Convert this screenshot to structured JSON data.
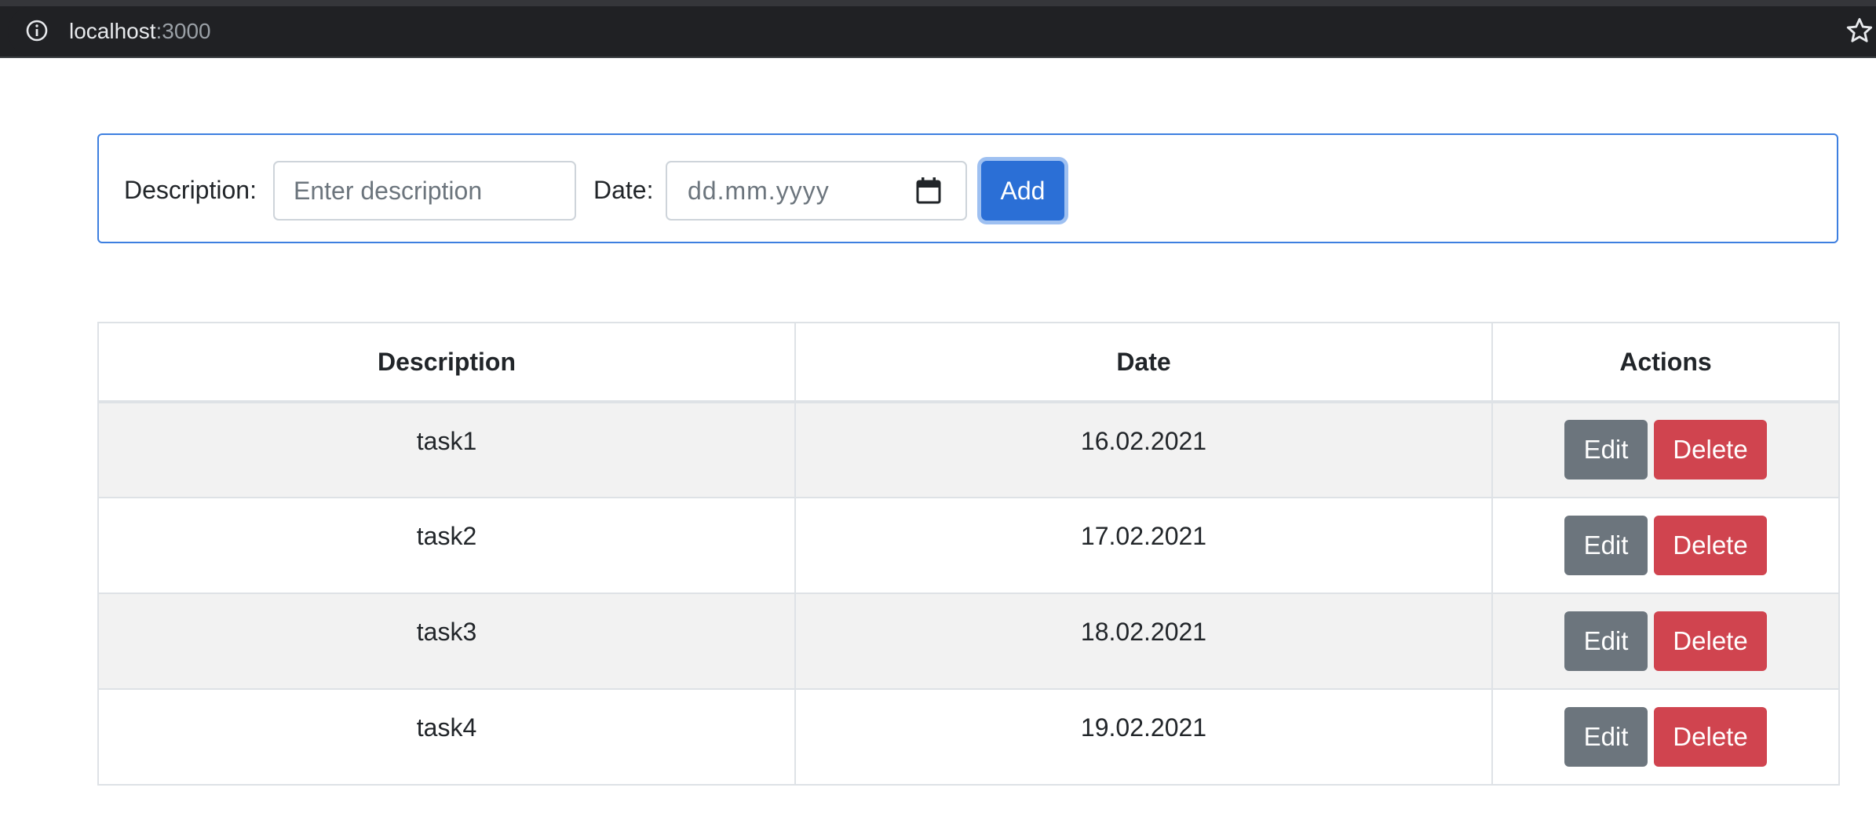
{
  "browser": {
    "url_host": "localhost",
    "url_port": ":3000"
  },
  "form": {
    "description_label": "Description:",
    "description_placeholder": "Enter description",
    "date_label": "Date:",
    "date_placeholder": "dd.mm.yyyy",
    "add_label": "Add"
  },
  "table": {
    "headers": [
      "Description",
      "Date",
      "Actions"
    ],
    "rows": [
      {
        "description": "task1",
        "date": "16.02.2021"
      },
      {
        "description": "task2",
        "date": "17.02.2021"
      },
      {
        "description": "task3",
        "date": "18.02.2021"
      },
      {
        "description": "task4",
        "date": "19.02.2021"
      }
    ],
    "edit_label": "Edit",
    "delete_label": "Delete"
  },
  "colors": {
    "primary": "#2b6fd6",
    "secondary": "#6c757d",
    "danger": "#d0444f",
    "striped_row": "#f2f2f2"
  }
}
